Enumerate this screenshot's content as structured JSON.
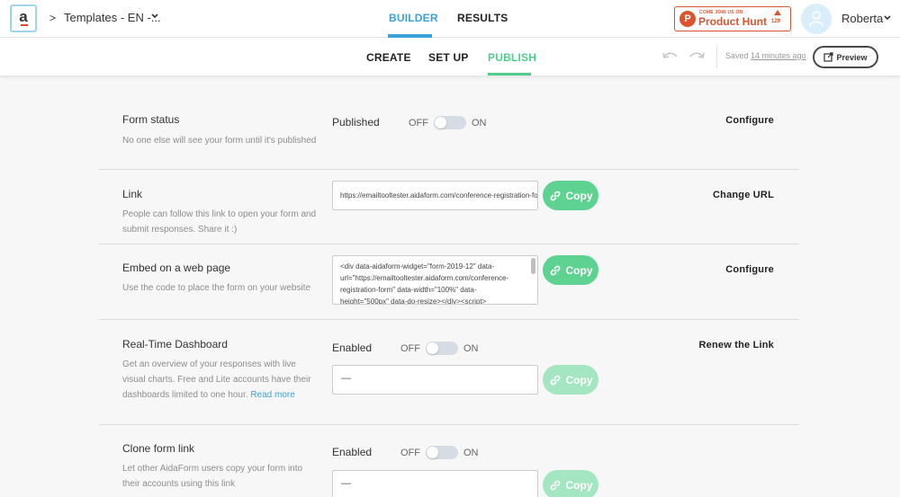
{
  "topbar": {
    "logo_letter": "a",
    "breadcrumb": "Templates - EN -...",
    "tabs": {
      "builder": "BUILDER",
      "results": "RESULTS"
    },
    "product_hunt": {
      "small": "COME JOIN US ON",
      "big": "Product Hunt",
      "count": "129",
      "letter": "P"
    },
    "user_name": "Roberta"
  },
  "subbar": {
    "tabs": {
      "create": "CREATE",
      "setup": "SET UP",
      "publish": "PUBLISH"
    },
    "saved_prefix": "Saved ",
    "saved_time": "14 minutes ago",
    "preview": "Preview"
  },
  "sections": {
    "status": {
      "title": "Form status",
      "desc": "No one else will see your form until it's published",
      "state": "Published",
      "off": "OFF",
      "on": "ON",
      "action": "Configure"
    },
    "link": {
      "title": "Link",
      "desc": "People can follow this link to open your form and submit responses. Share it :)",
      "url": "https://emailtooltester.aidaform.com/conference-registration-form",
      "copy": "Copy",
      "action": "Change URL"
    },
    "embed": {
      "title": "Embed on a web page",
      "desc": "Use the code to place the form on your website",
      "code": "<div data-aidaform-widget=\"form-2019-12\" data-url=\"https://emailtooltester.aidaform.com/conference-registration-form\" data-width=\"100%\" data-height=\"500px\" data-do-resize></div><script>",
      "copy": "Copy",
      "action": "Configure"
    },
    "dashboard": {
      "title": "Real-Time Dashboard",
      "desc": "Get an overview of your responses with live visual charts. Free and Lite accounts have their dashboards limited to one hour.",
      "read_more": "Read more",
      "state": "Enabled",
      "off": "OFF",
      "on": "ON",
      "value": "—",
      "copy": "Copy",
      "action": "Renew the Link"
    },
    "clone": {
      "title": "Clone form link",
      "desc": "Let other AidaForm users copy your form into their accounts using this link",
      "state": "Enabled",
      "off": "OFF",
      "on": "ON",
      "value": "—",
      "copy": "Copy"
    }
  }
}
